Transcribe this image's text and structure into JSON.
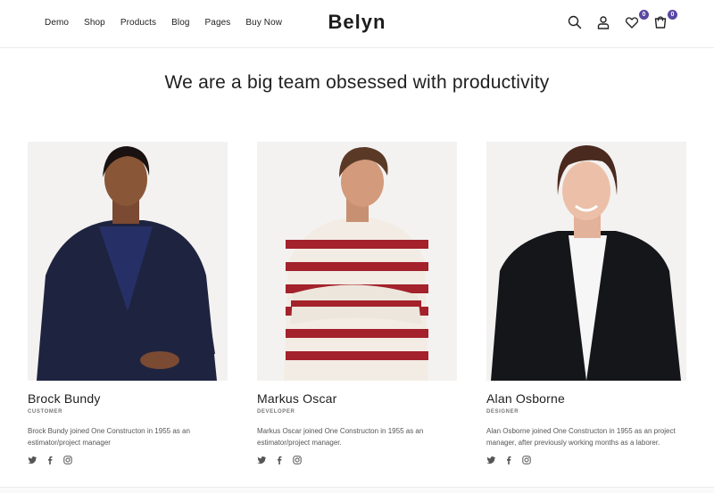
{
  "header": {
    "nav": [
      "Demo",
      "Shop",
      "Products",
      "Blog",
      "Pages",
      "Buy Now"
    ],
    "logo": "Belyn",
    "wishlist_count": "0",
    "cart_count": "0",
    "icons": [
      "search-icon",
      "user-icon",
      "heart-icon",
      "cart-icon"
    ]
  },
  "section": {
    "title": "We are a big team obsessed with productivity"
  },
  "team": [
    {
      "name": "Brock Bundy",
      "role": "CUSTOMER",
      "bio": "Brock Bundy joined One Constructon in 1955 as an estimator/project manager"
    },
    {
      "name": "Markus Oscar",
      "role": "DEVELOPER",
      "bio": "Markus Oscar joined One Constructon in 1955 as an estimator/project manager."
    },
    {
      "name": "Alan Osborne",
      "role": "DESIGNER",
      "bio": "Alan Osborne joined One Constructon in 1955 as an project manager, after previously working months as a laborer."
    }
  ],
  "social_icons": [
    "twitter-icon",
    "facebook-icon",
    "instagram-icon"
  ],
  "colors": {
    "accent": "#5a47a3",
    "text": "#222222",
    "muted": "#777777"
  }
}
